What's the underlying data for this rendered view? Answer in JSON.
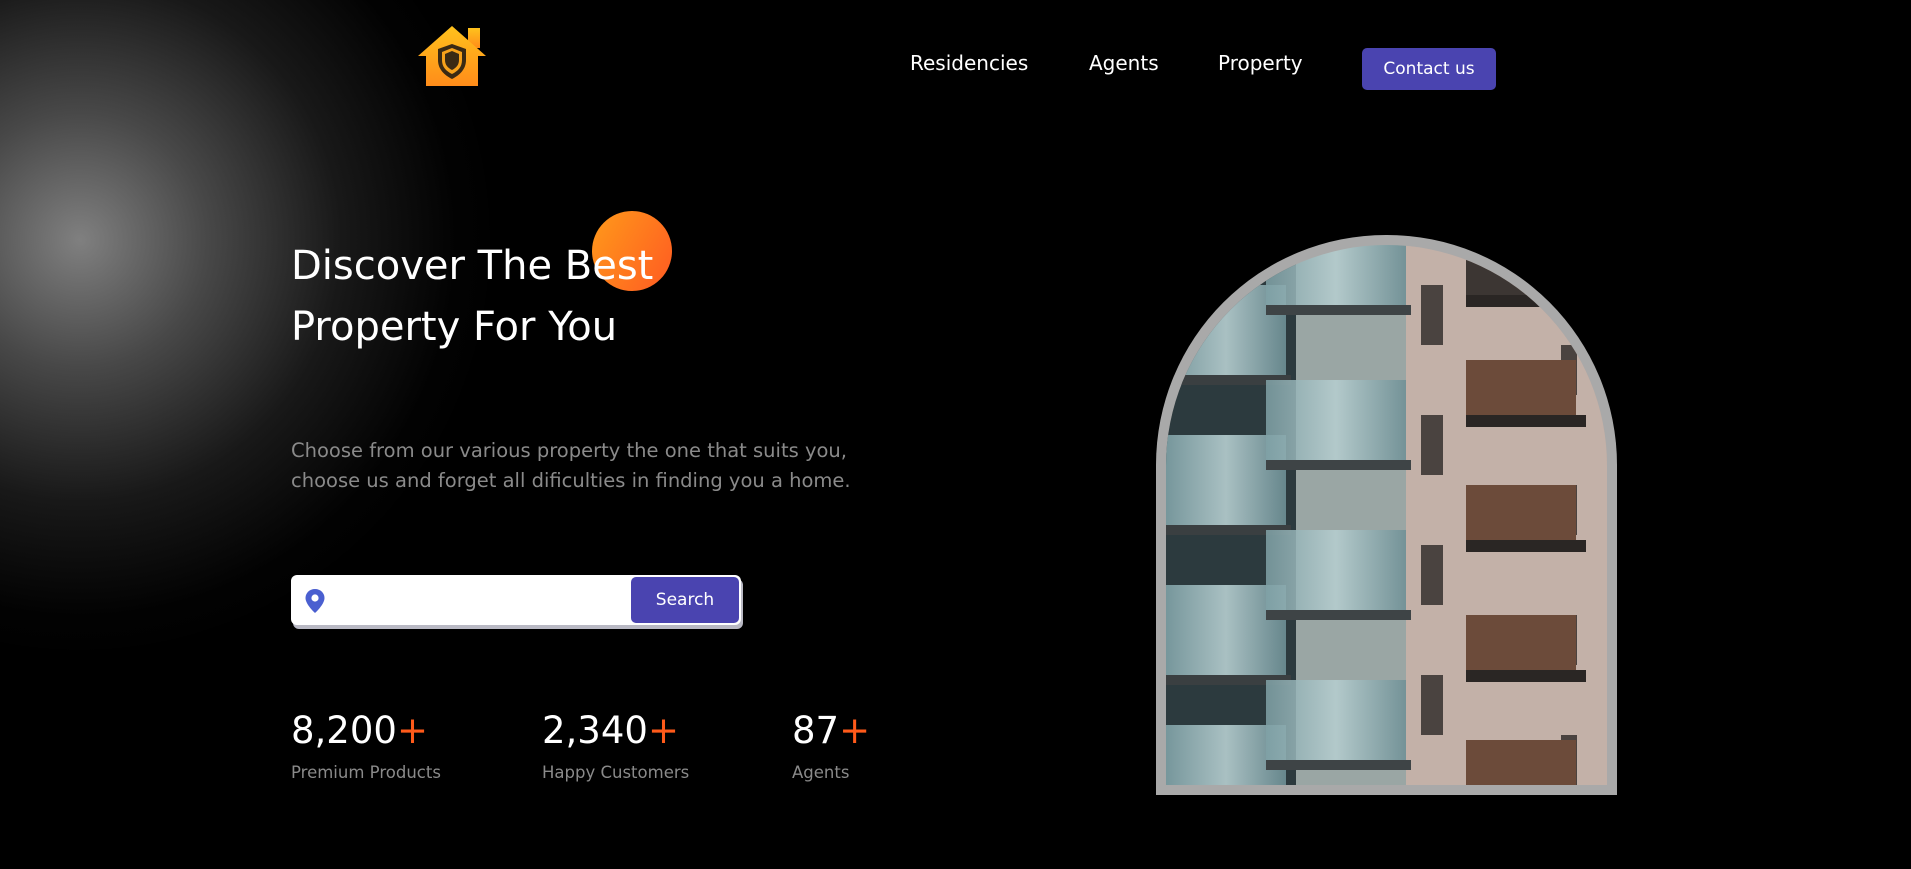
{
  "brand": {
    "logo_icon": "house-shield-icon",
    "colors": {
      "logo_top": "#ffb81c",
      "logo_bottom": "#ff8a1a",
      "shield_fill": "#3a2a14"
    }
  },
  "nav": {
    "items": [
      {
        "label": "Residencies"
      },
      {
        "label": "Agents"
      },
      {
        "label": "Property"
      }
    ],
    "contact_label": "Contact us"
  },
  "hero": {
    "title_lines": [
      "Discover The Best",
      "Property For You"
    ],
    "description_lines": [
      "Choose from our various property the one that suits you,",
      "choose us and forget all dificulties in finding you a home."
    ]
  },
  "search": {
    "icon": "location-pin-icon",
    "value": "",
    "placeholder": "",
    "button_label": "Search"
  },
  "stats": [
    {
      "value": "8,200",
      "suffix": "+",
      "label": "Premium Products"
    },
    {
      "value": "2,340",
      "suffix": "+",
      "label": "Happy Customers"
    },
    {
      "value": "87",
      "suffix": "+",
      "label": "Agents"
    }
  ],
  "hero_image": {
    "subject": "apartment-building-photo"
  },
  "colors": {
    "accent": "#4a44b0",
    "orange": "#ff5a1a",
    "background": "#000000",
    "muted_text": "#8a8a8a"
  }
}
